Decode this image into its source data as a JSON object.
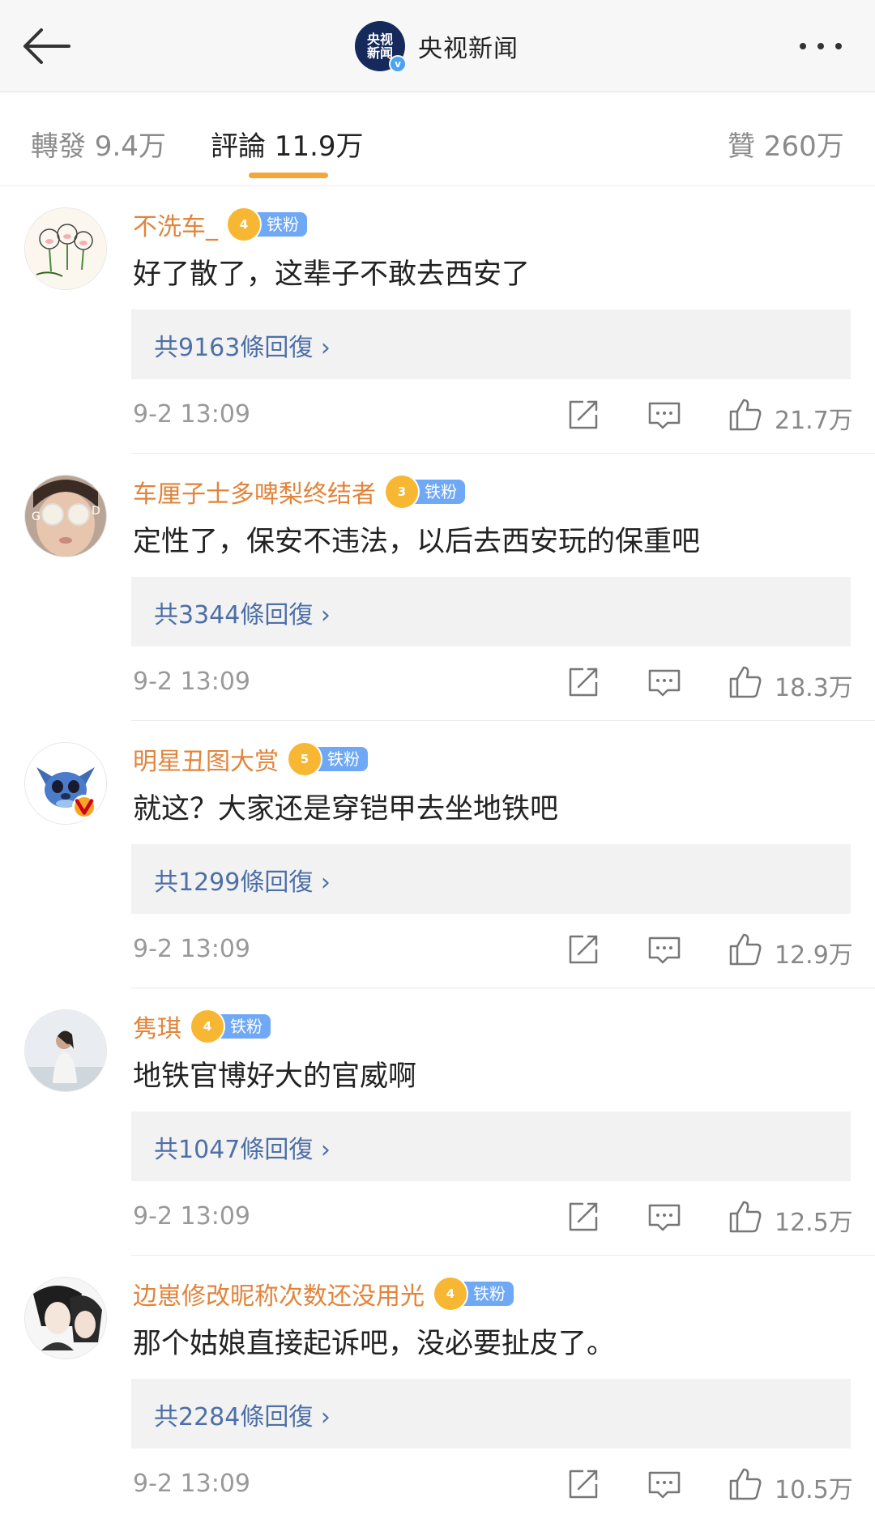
{
  "header": {
    "title": "央视新闻",
    "logo_line1": "央视",
    "logo_line2": "新闻",
    "verified_mark": "v"
  },
  "tabs": {
    "repost": "轉發 9.4万",
    "comments": "評論 11.9万",
    "likes": "贊 260万"
  },
  "colors": {
    "accent_underline": "#f4a63a",
    "username": "#e2843a",
    "reply_link": "#4d6fa7",
    "fan_badge": "#6fa8f5"
  },
  "comments": [
    {
      "username": "不洗车_",
      "badge_level": "4",
      "badge_text": "铁粉",
      "text": "好了散了，这辈子不敢去西安了",
      "replies": "共9163條回復 ›",
      "time": "9-2 13:09",
      "likes": "21.7万"
    },
    {
      "username": "车厘子士多啤梨终结者",
      "badge_level": "3",
      "badge_text": "铁粉",
      "text": "定性了，保安不违法，以后去西安玩的保重吧",
      "replies": "共3344條回復 ›",
      "time": "9-2 13:09",
      "likes": "18.3万"
    },
    {
      "username": "明星丑图大赏",
      "badge_level": "5",
      "badge_text": "铁粉",
      "text": "就这？大家还是穿铠甲去坐地铁吧",
      "replies": "共1299條回復 ›",
      "time": "9-2 13:09",
      "likes": "12.9万"
    },
    {
      "username": "隽琪",
      "badge_level": "4",
      "badge_text": "铁粉",
      "text": "地铁官博好大的官威啊",
      "replies": "共1047條回復 ›",
      "time": "9-2 13:09",
      "likes": "12.5万"
    },
    {
      "username": "边崽修改昵称次数还没用光",
      "badge_level": "4",
      "badge_text": "铁粉",
      "text": "那个姑娘直接起诉吧，没必要扯皮了。",
      "replies": "共2284條回復 ›",
      "time": "9-2 13:09",
      "likes": "10.5万"
    }
  ]
}
